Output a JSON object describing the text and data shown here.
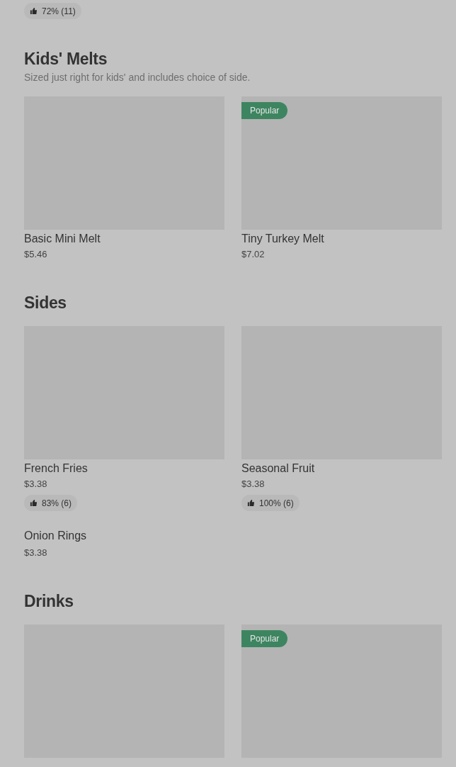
{
  "top_rating": "72% (11)",
  "sections": [
    {
      "title": "Kids' Melts",
      "subtitle": "Sized just right for kids' and includes choice of side.",
      "items": [
        {
          "kind": "picture",
          "name": "Basic Mini Melt",
          "price": "$5.46"
        },
        {
          "kind": "picture",
          "badge": "Popular",
          "name": "Tiny Turkey Melt",
          "price": "$7.02"
        }
      ]
    },
    {
      "title": "Sides",
      "items": [
        {
          "kind": "picture",
          "name": "French Fries",
          "price": "$3.38",
          "rating": "83% (6)"
        },
        {
          "kind": "picture",
          "name": "Seasonal Fruit",
          "price": "$3.38",
          "rating": "100% (6)"
        },
        {
          "kind": "text",
          "name": "Onion Rings",
          "price": "$3.38"
        }
      ]
    },
    {
      "title": "Drinks",
      "items": [
        {
          "kind": "picture"
        },
        {
          "kind": "picture",
          "badge": "Popular"
        }
      ]
    }
  ]
}
